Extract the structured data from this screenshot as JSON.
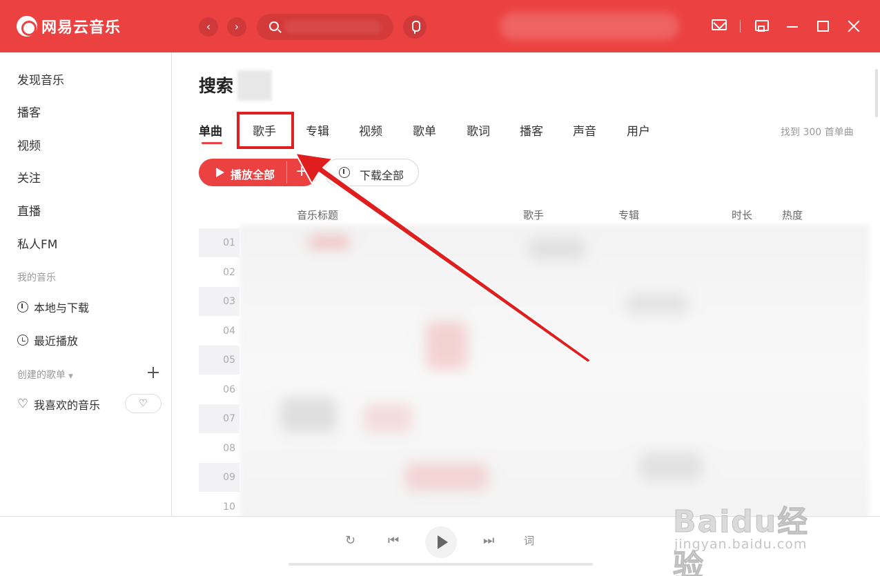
{
  "app": {
    "name": "网易云音乐",
    "brand_color": "#ec4141"
  },
  "sidebar": {
    "items": [
      {
        "label": "发现音乐"
      },
      {
        "label": "播客"
      },
      {
        "label": "视频"
      },
      {
        "label": "关注"
      },
      {
        "label": "直播"
      },
      {
        "label": "私人FM"
      }
    ],
    "section_my_music": "我的音乐",
    "local_download": "本地与下载",
    "recent_play": "最近播放",
    "section_created": "创建的歌单",
    "liked_music": "我喜欢的音乐"
  },
  "main": {
    "title": "搜索",
    "tabs": [
      {
        "label": "单曲",
        "active": true
      },
      {
        "label": "歌手",
        "active": false
      },
      {
        "label": "专辑",
        "active": false
      },
      {
        "label": "视频",
        "active": false
      },
      {
        "label": "歌单",
        "active": false
      },
      {
        "label": "歌词",
        "active": false
      },
      {
        "label": "播客",
        "active": false
      },
      {
        "label": "声音",
        "active": false
      },
      {
        "label": "用户",
        "active": false
      }
    ],
    "result_count": "找到 300 首单曲",
    "play_all": "播放全部",
    "download_all": "下载全部",
    "columns": {
      "title": "音乐标题",
      "artist": "歌手",
      "album": "专辑",
      "duration": "时长",
      "popularity": "热度"
    },
    "rows": [
      "01",
      "02",
      "03",
      "04",
      "05",
      "06",
      "07",
      "08",
      "09",
      "10"
    ]
  },
  "player": {
    "lyrics_label": "词"
  },
  "watermark": {
    "main": "Baidu经验",
    "sub": "jingyan.baidu.com"
  }
}
